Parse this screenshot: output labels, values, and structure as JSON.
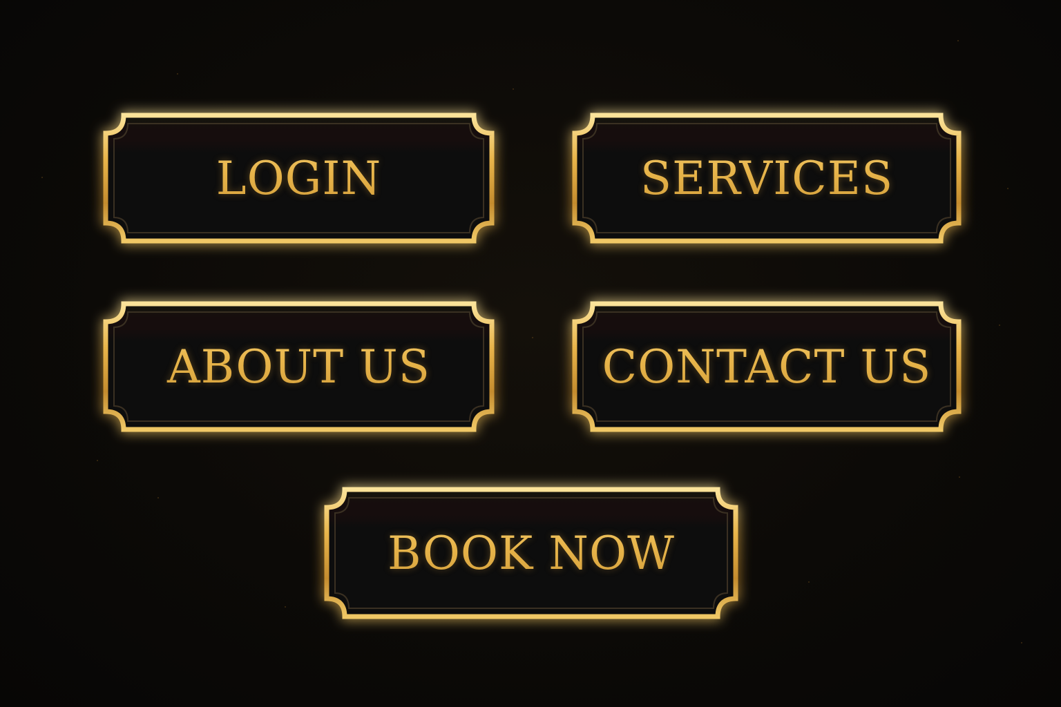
{
  "buttons": {
    "login": "LOGIN",
    "services": "SERVICES",
    "about": "ABOUT US",
    "contact": "CONTACT US",
    "book": "BOOK NOW"
  },
  "colors": {
    "background": "#0b0906",
    "gold": "#e6b54a",
    "gold_light": "#fbe39a",
    "gold_dark": "#b8832a",
    "plaque_fill": "#0d0c0a"
  }
}
